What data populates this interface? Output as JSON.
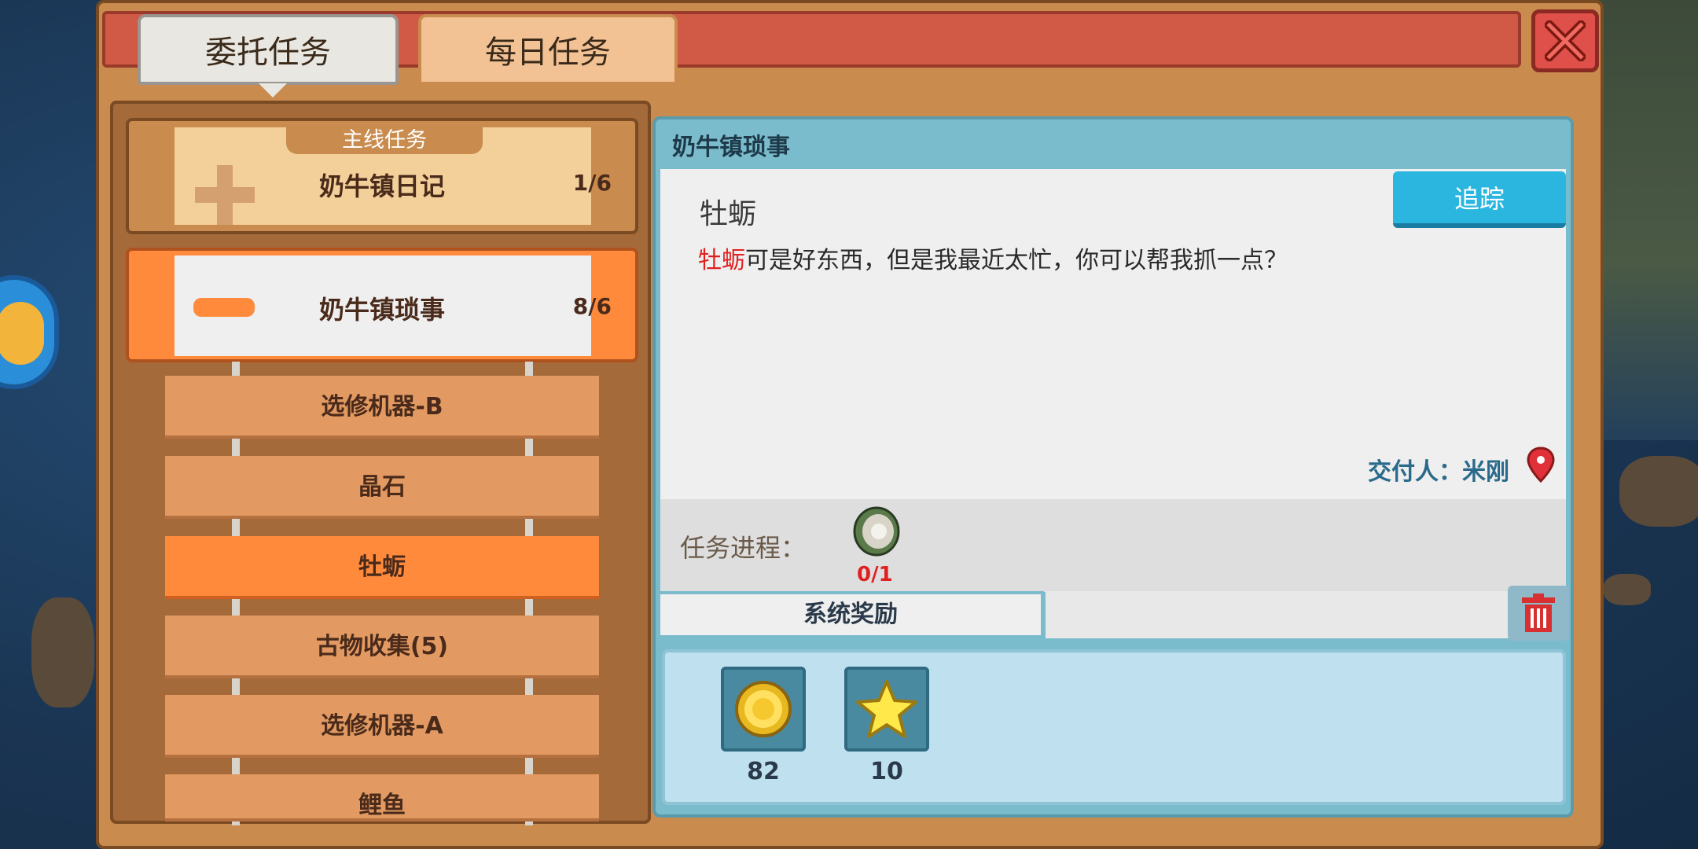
{
  "tabs": {
    "commission": "委托任务",
    "daily": "每日任务"
  },
  "categories": [
    {
      "tag": "主线任务",
      "title": "奶牛镇日记",
      "count": "1/6"
    },
    {
      "title": "奶牛镇琐事",
      "count": "8/6"
    }
  ],
  "quest_list": [
    "选修机器-B",
    "晶石",
    "牡蛎",
    "古物收集(5)",
    "选修机器-A",
    "鲤鱼"
  ],
  "detail": {
    "header": "奶牛镇琐事",
    "name": "牡蛎",
    "text_highlight": "牡蛎",
    "text_rest": "可是好东西，但是我最近太忙，你可以帮我抓一点？",
    "track_button": "追踪",
    "giver": "交付人：米刚",
    "progress_label": "任务进程：",
    "progress_count": "0/1",
    "reward_tab": "系统奖励",
    "rewards": [
      {
        "icon": "gold-coin-icon",
        "count": "82"
      },
      {
        "icon": "star-icon",
        "count": "10"
      }
    ]
  }
}
